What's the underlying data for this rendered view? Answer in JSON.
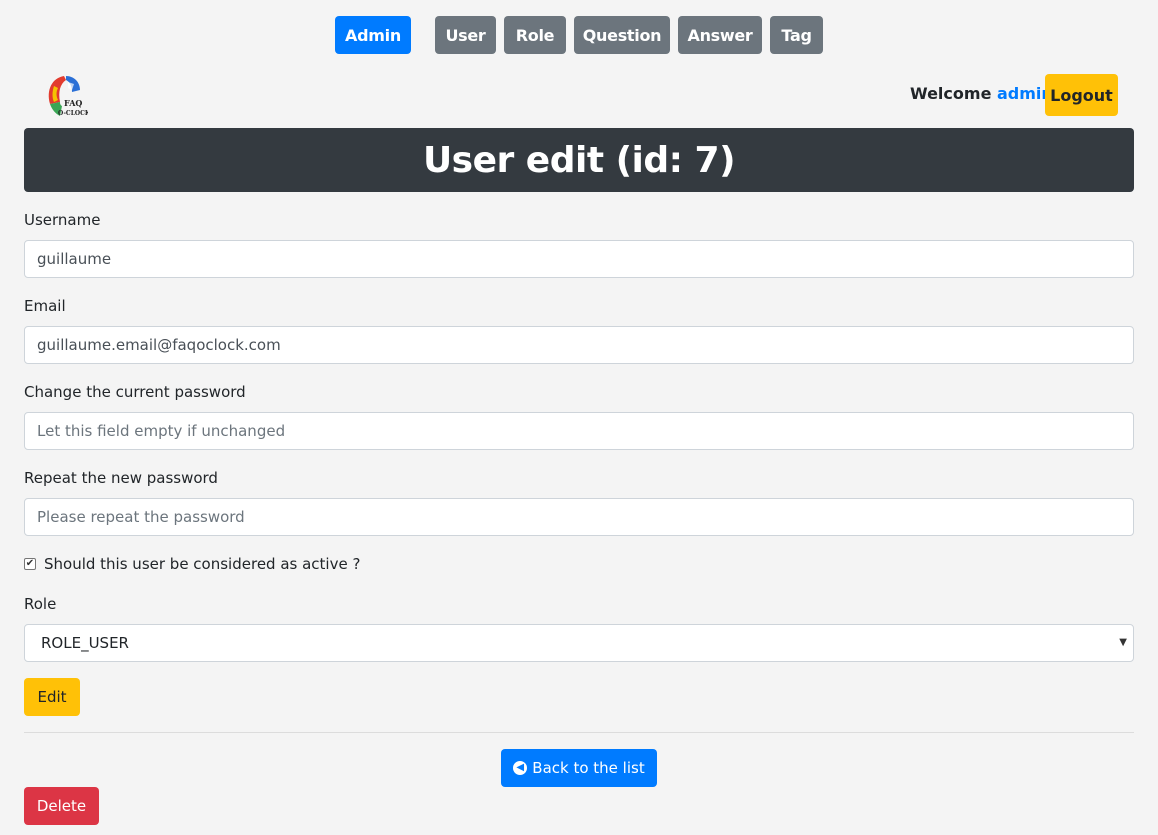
{
  "nav": {
    "items": [
      {
        "label": "Admin",
        "style": "primary"
      },
      {
        "label": "User",
        "style": "secondary"
      },
      {
        "label": "Role",
        "style": "secondary"
      },
      {
        "label": "Question",
        "style": "secondary"
      },
      {
        "label": "Answer",
        "style": "secondary"
      },
      {
        "label": "Tag",
        "style": "secondary"
      }
    ]
  },
  "header": {
    "logo_text": "FAQ O-CLOCK",
    "welcome_label": "Welcome",
    "username": "admin",
    "logout_label": "Logout"
  },
  "page": {
    "title": "User edit (id: 7)"
  },
  "form": {
    "username_label": "Username",
    "username_value": "guillaume",
    "email_label": "Email",
    "email_value": "guillaume.email@faqoclock.com",
    "password_label": "Change the current password",
    "password_placeholder": "Let this field empty if unchanged",
    "repeat_label": "Repeat the new password",
    "repeat_placeholder": "Please repeat the password",
    "active_label": "Should this user be considered as active ?",
    "active_checked": true,
    "role_label": "Role",
    "role_value": "ROLE_USER",
    "edit_label": "Edit"
  },
  "actions": {
    "back_label": "Back to the list",
    "delete_label": "Delete"
  },
  "colors": {
    "primary": "#007bff",
    "secondary": "#6c757d",
    "warning": "#ffc107",
    "danger": "#dc3545",
    "dark": "#343a40"
  },
  "icons": {
    "back": "arrow-circle-left-icon",
    "check": "checkmark-icon",
    "caret": "caret-down-icon"
  }
}
